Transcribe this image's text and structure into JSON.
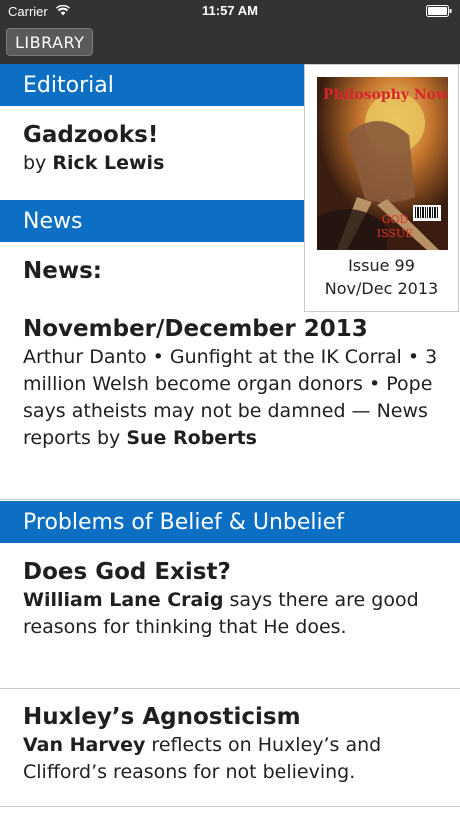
{
  "status": {
    "carrier": "Carrier",
    "time": "11:57 AM"
  },
  "nav": {
    "library_label": "LIBRARY"
  },
  "cover": {
    "masthead": "Philosophy Now",
    "badge_line1": "GOD",
    "badge_line2": "ISSUE",
    "issue": "Issue 99",
    "date": "Nov/Dec 2013"
  },
  "sections": {
    "editorial": "Editorial",
    "news": "News",
    "belief": "Problems of Belief & Unbelief"
  },
  "articles": {
    "gadzooks": {
      "title": "Gadzooks!",
      "by": "by ",
      "author": "Rick Lewis"
    },
    "news": {
      "title_line1": "News:",
      "title_line2": "November/December 2013",
      "summary": "Arthur Danto • Gunfight at the IK Corral • 3 million Welsh become organ donors • Pope says atheists may not be damned — News reports by ",
      "author": "Sue Roberts"
    },
    "god": {
      "title": "Does God Exist?",
      "author": "William Lane Craig",
      "summary": " says there are good reasons for thinking that He does."
    },
    "huxley": {
      "title": "Huxley’s Agnosticism",
      "author": "Van Harvey",
      "summary": " reflects on Huxley’s and Clifford’s reasons for not believing."
    }
  },
  "colors": {
    "nav_bg": "#333333",
    "section_blue": "#0c6fc4"
  }
}
